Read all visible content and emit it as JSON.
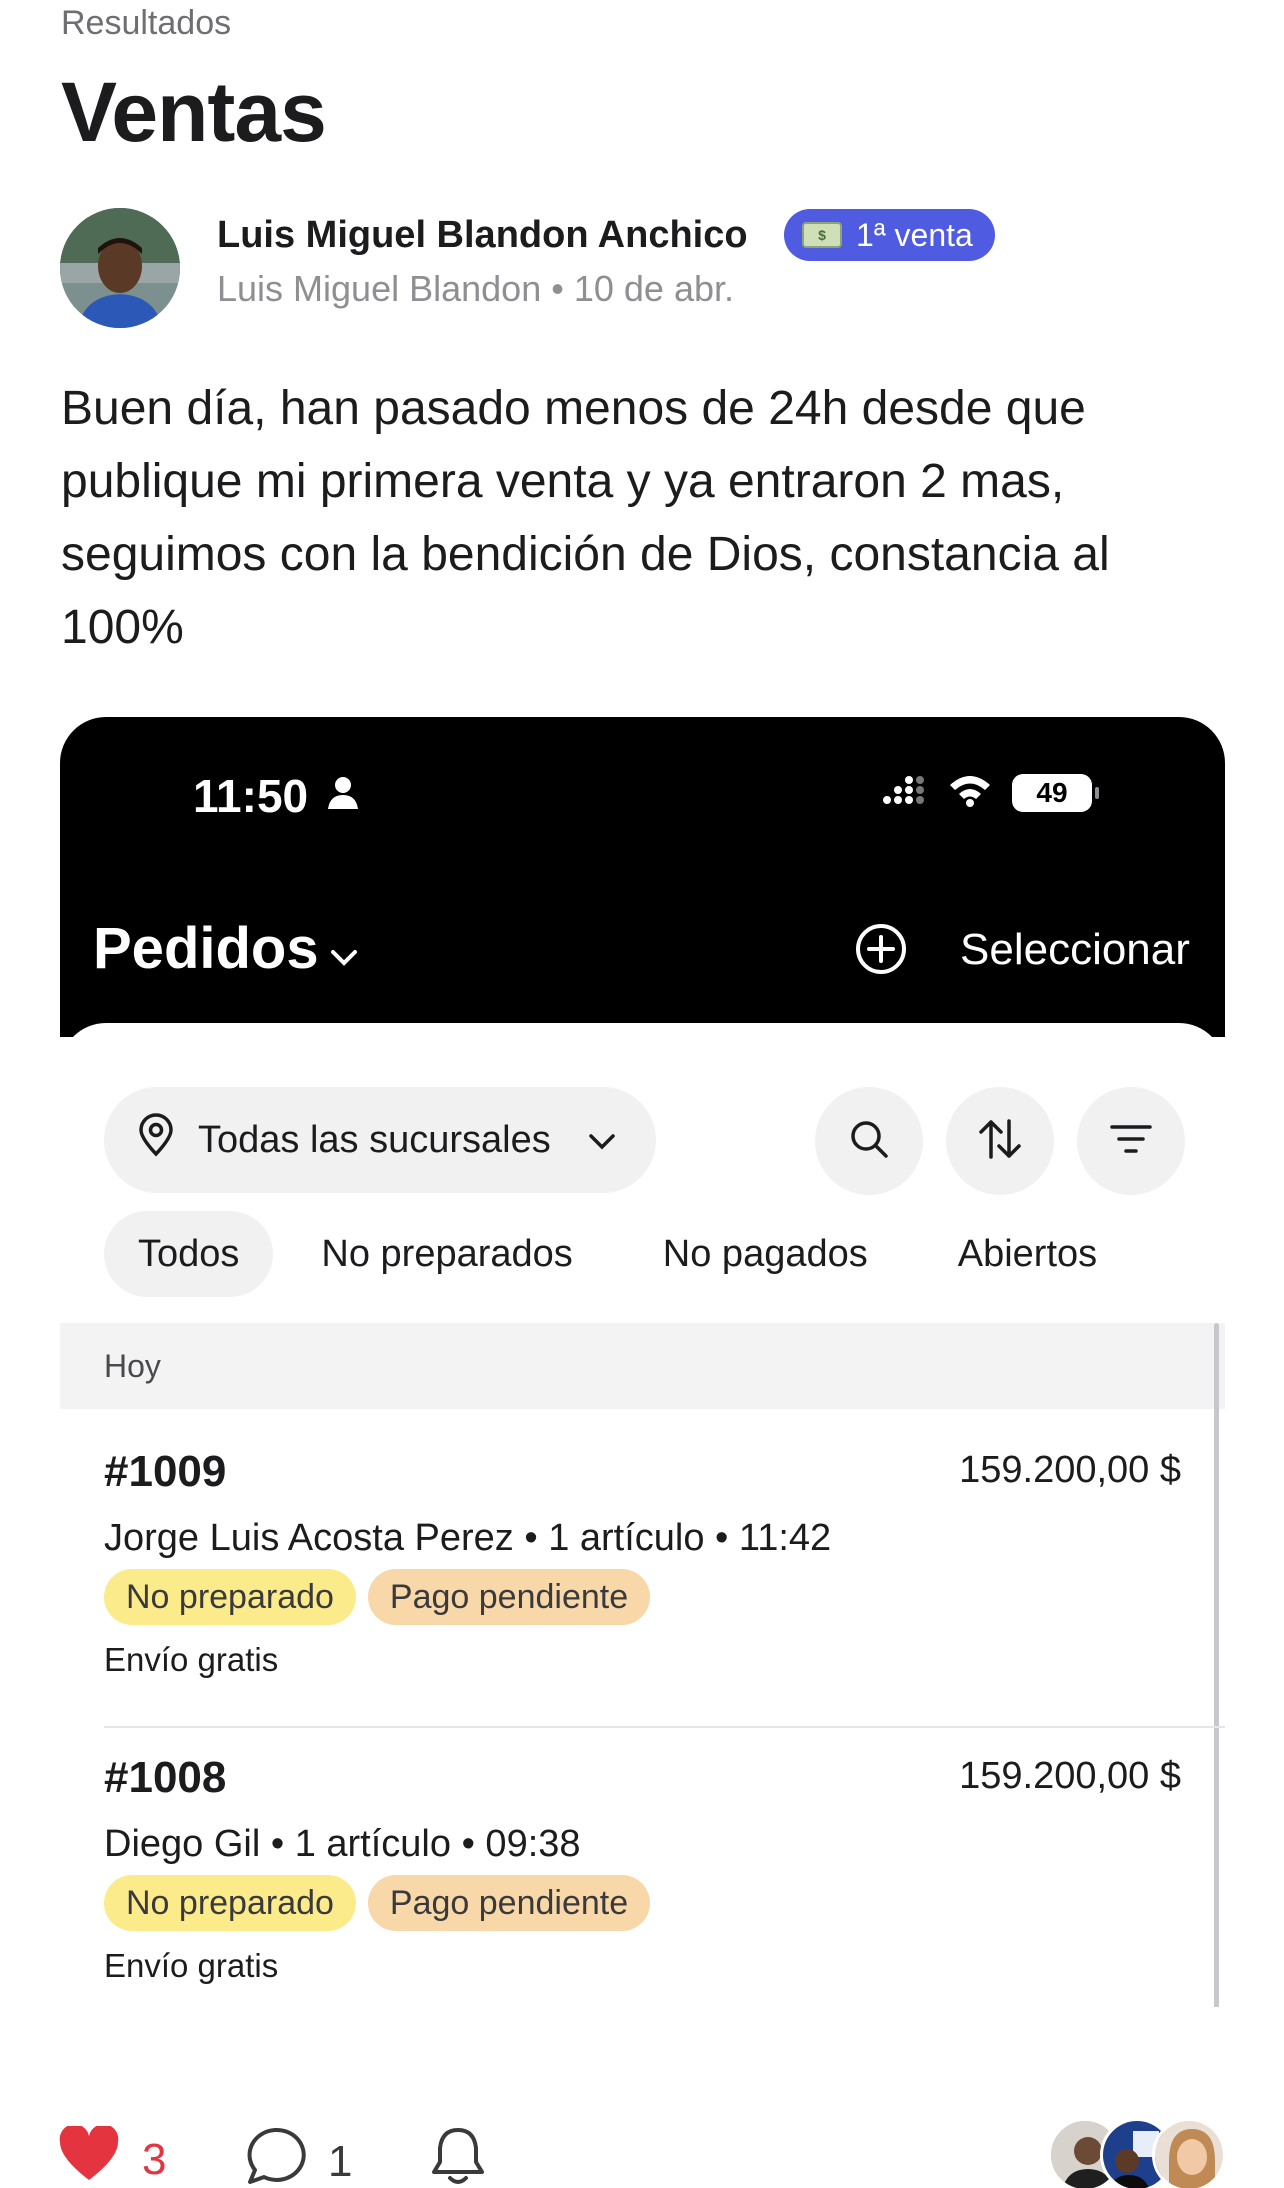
{
  "header": {
    "breadcrumb": "Resultados",
    "title": "Ventas"
  },
  "post": {
    "author_name": "Luis Miguel Blandon Anchico",
    "badge_label": "1ª venta",
    "badge_icon": "money-bill-icon",
    "author_handle": "Luis Miguel Blandon",
    "separator": "•",
    "date": "10 de abr.",
    "body": "Buen día, han pasado menos de 24h desde que publique mi primera venta y ya entraron 2 mas, seguimos con la bendición de Dios, constancia al 100%"
  },
  "screenshot": {
    "status_time": "11:50",
    "battery": "49",
    "title": "Pedidos",
    "select_label": "Seleccionar",
    "location_filter": "Todas las sucursales",
    "tabs": [
      "Todos",
      "No preparados",
      "No pagados",
      "Abiertos"
    ],
    "section": "Hoy",
    "orders": [
      {
        "id": "#1009",
        "amount": "159.200,00 $",
        "meta": "Jorge Luis Acosta Perez • 1 artículo • 11:42",
        "tag1": "No preparado",
        "tag2": "Pago pendiente",
        "shipping": "Envío gratis"
      },
      {
        "id": "#1008",
        "amount": "159.200,00 $",
        "meta": "Diego Gil • 1 artículo • 09:38",
        "tag1": "No preparado",
        "tag2": "Pago pendiente",
        "shipping": "Envío gratis"
      }
    ]
  },
  "actions": {
    "likes": "3",
    "comments": "1"
  },
  "colors": {
    "accent_badge": "#4f5be0",
    "like_red": "#e3343f",
    "tag_yellow": "#fbeb8b",
    "tag_orange": "#f8d7a8"
  }
}
